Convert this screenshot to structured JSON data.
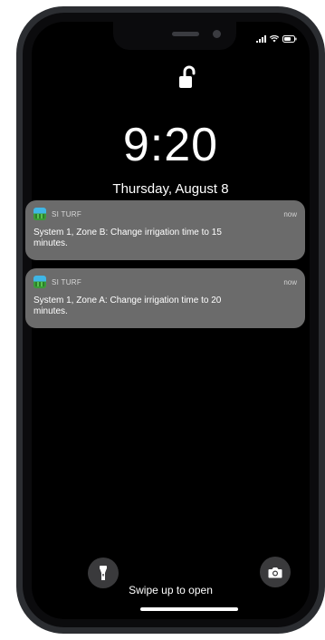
{
  "status": {
    "signal_icon": "signal-bars-icon",
    "wifi_icon": "wifi-icon",
    "battery_icon": "battery-icon"
  },
  "lock": {
    "icon": "unlocked-padlock-icon",
    "time": "9:20",
    "date": "Thursday, August 8"
  },
  "notifications": [
    {
      "app_name": "SI TURF",
      "time": "now",
      "body": "System 1, Zone B: Change irrigation time to 15 minutes."
    },
    {
      "app_name": "SI TURF",
      "time": "now",
      "body": "System 1, Zone A: Change irrigation time to 20 minutes."
    }
  ],
  "bottom": {
    "flashlight_icon": "flashlight-icon",
    "camera_icon": "camera-icon",
    "swipe_label": "Swipe up to open"
  },
  "colors": {
    "screen_bg": "#000000",
    "notification_bg": "#6b6b6b",
    "phone_frame": "#2b2d31"
  }
}
